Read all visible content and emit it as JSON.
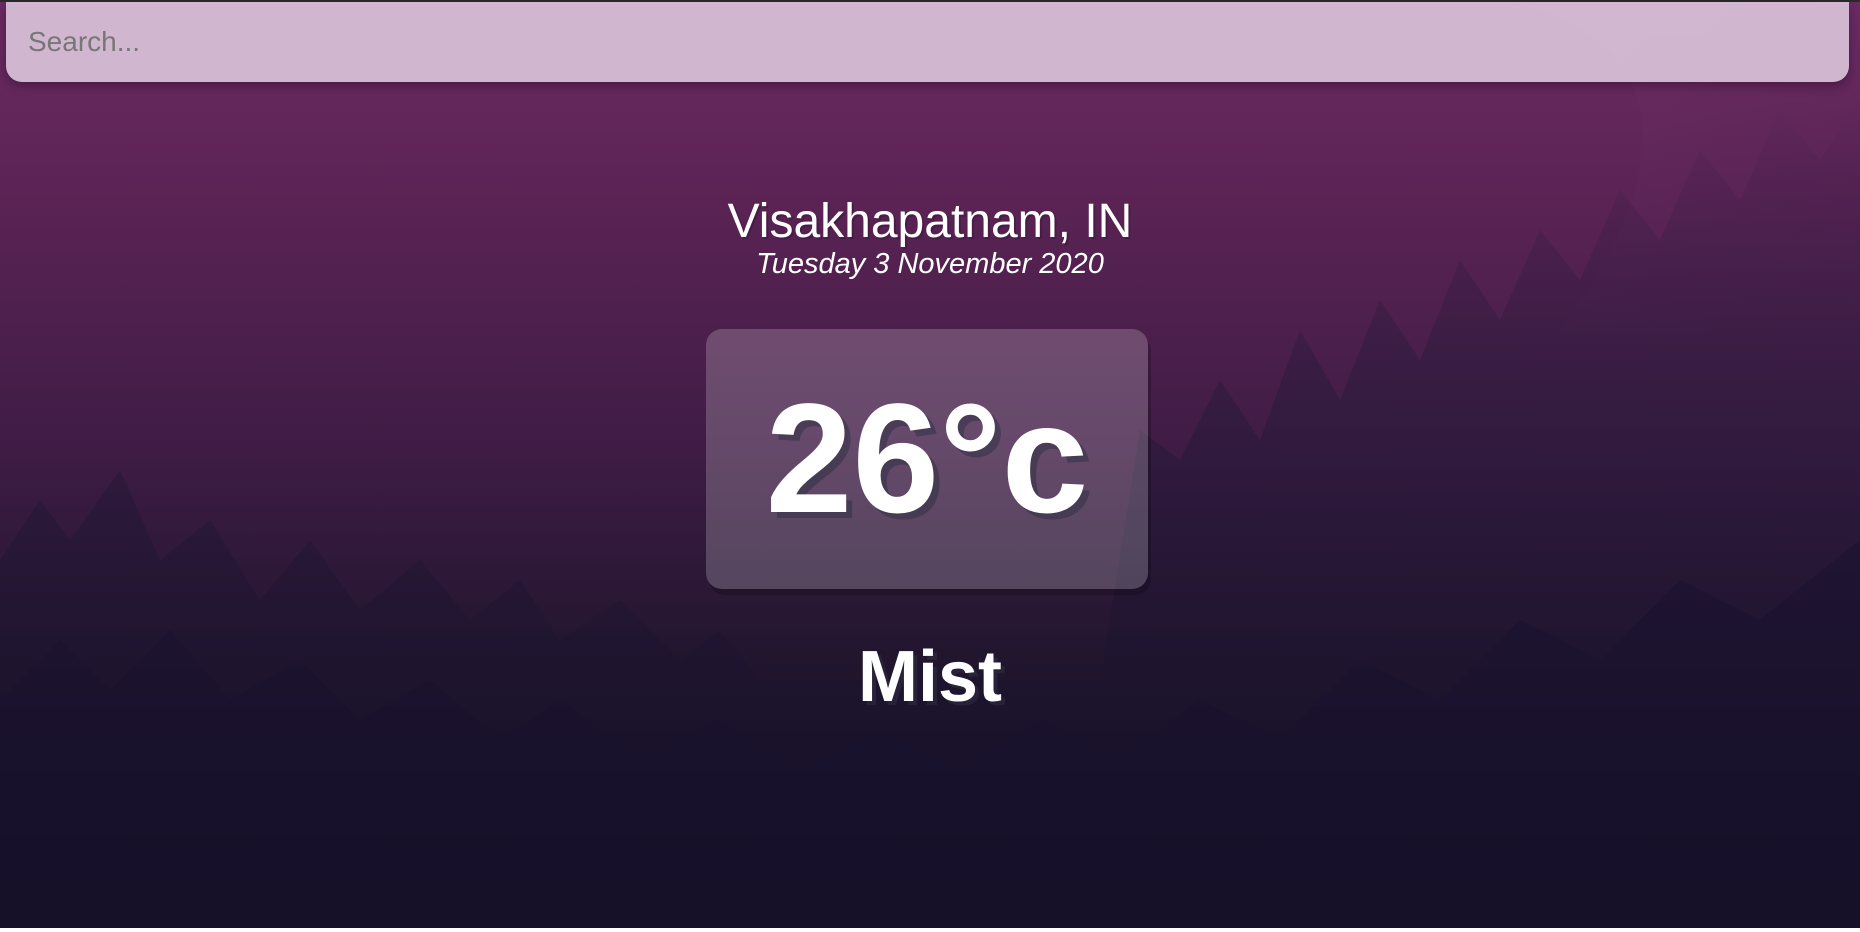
{
  "search": {
    "placeholder": "Search...",
    "value": ""
  },
  "location": {
    "city_country": "Visakhapatnam, IN",
    "date": "Tuesday 3 November 2020"
  },
  "weather": {
    "temperature": "26°c",
    "condition": "Mist"
  },
  "colors": {
    "background_top": "#6d2b63",
    "background_bottom": "#0c0a18",
    "search_bar": "#e8d6e8",
    "text": "#ffffff"
  }
}
